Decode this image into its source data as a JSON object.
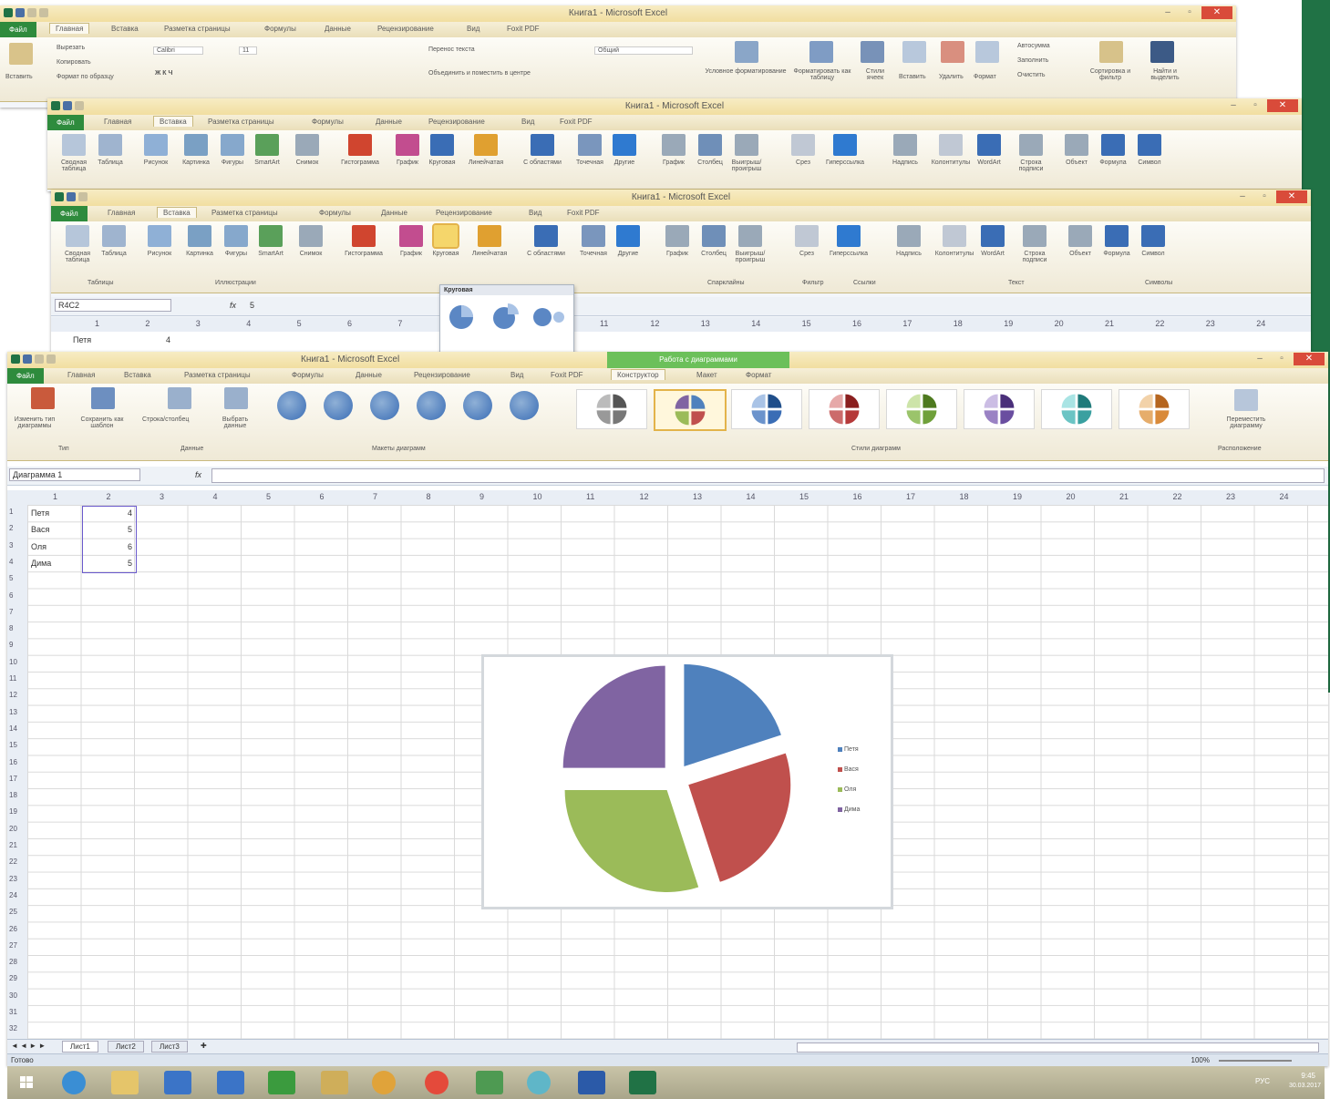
{
  "window": {
    "title": "Книга1 - Microsoft Excel"
  },
  "tabs": {
    "file": "Файл",
    "home": "Главная",
    "insert": "Вставка",
    "page_layout": "Разметка страницы",
    "formulas": "Формулы",
    "data": "Данные",
    "review": "Рецензирование",
    "view": "Вид",
    "foxit": "Foxit PDF",
    "design": "Конструктор",
    "layout": "Макет",
    "format": "Формат",
    "chart_tools": "Работа с диаграммами"
  },
  "home_ribbon": {
    "paste": "Вставить",
    "cut": "Вырезать",
    "copy": "Копировать",
    "format_painter": "Формат по образцу",
    "font": "Calibri",
    "font_size": "11",
    "wrap_text": "Перенос текста",
    "merge": "Объединить и поместить в центре",
    "number_format": "Общий",
    "conditional": "Условное форматирование",
    "format_table": "Форматировать как таблицу",
    "cell_styles": "Стили ячеек",
    "insert": "Вставить",
    "delete": "Удалить",
    "format": "Формат",
    "autosum": "Автосумма",
    "fill": "Заполнить",
    "clear": "Очистить",
    "sort": "Сортировка и фильтр",
    "find": "Найти и выделить"
  },
  "insert_ribbon": {
    "pivot": "Сводная таблица",
    "table": "Таблица",
    "picture": "Рисунок",
    "clipart": "Картинка",
    "shapes": "Фигуры",
    "smartart": "SmartArt",
    "screenshot": "Снимок",
    "histogram": "Гистограмма",
    "line": "График",
    "pie": "Круговая",
    "bar": "Линейчатая",
    "area": "С областями",
    "scatter": "Точечная",
    "other": "Другие",
    "spark_line": "График",
    "spark_column": "Столбец",
    "spark_winloss": "Выигрыш/проигрыш",
    "slicer": "Срез",
    "hyperlink": "Гиперссылка",
    "textbox": "Надпись",
    "header": "Колонтитулы",
    "wordart": "WordArt",
    "signature": "Строка подписи",
    "object": "Объект",
    "equation": "Формула",
    "symbol": "Символ",
    "group_tables": "Таблицы",
    "group_illustrations": "Иллюстрации",
    "group_sparklines": "Спарклайны",
    "group_filter": "Фильтр",
    "group_links": "Ссылки",
    "group_text": "Текст",
    "group_symbols": "Символы"
  },
  "pie_dropdown": {
    "header": "Круговая"
  },
  "window3_formula": {
    "name_box": "R4C2",
    "fx": "fx",
    "value": "5",
    "cell_a1": "Петя",
    "cell_b1": "4"
  },
  "design_ribbon": {
    "change_type": "Изменить тип диаграммы",
    "save_template": "Сохранить как шаблон",
    "switch_rowcol": "Строка/столбец",
    "select_data": "Выбрать данные",
    "move_chart": "Переместить диаграмму",
    "group_type": "Тип",
    "group_data": "Данные",
    "group_layouts": "Макеты диаграмм",
    "group_styles": "Стили диаграмм",
    "group_location": "Расположение"
  },
  "formula_bar": {
    "name_box": "Диаграмма 1",
    "fx": "fx",
    "value": ""
  },
  "columns": [
    "1",
    "2",
    "3",
    "4",
    "5",
    "6",
    "7",
    "8",
    "9",
    "10",
    "11",
    "12",
    "13",
    "14",
    "15",
    "16",
    "17",
    "18",
    "19",
    "20",
    "21",
    "22",
    "23",
    "24"
  ],
  "rows": [
    "1",
    "2",
    "3",
    "4",
    "5",
    "6",
    "7",
    "8",
    "9",
    "10",
    "11",
    "12",
    "13",
    "14",
    "15",
    "16",
    "17",
    "18",
    "19",
    "20",
    "21",
    "22",
    "23",
    "24",
    "25",
    "26",
    "27",
    "28",
    "29",
    "30",
    "31",
    "32"
  ],
  "table": [
    {
      "name": "Петя",
      "value": "4"
    },
    {
      "name": "Вася",
      "value": "5"
    },
    {
      "name": "Оля",
      "value": "6"
    },
    {
      "name": "Дима",
      "value": "5"
    }
  ],
  "chart_data": {
    "type": "pie",
    "exploded": true,
    "categories": [
      "Петя",
      "Вася",
      "Оля",
      "Дима"
    ],
    "values": [
      4,
      5,
      6,
      5
    ],
    "colors": [
      "#4f81bd",
      "#c0504d",
      "#9bbb59",
      "#8064a2"
    ],
    "legend": "right"
  },
  "sheets": {
    "active": "Лист1",
    "s2": "Лист2",
    "s3": "Лист3"
  },
  "status": {
    "ready": "Готово",
    "zoom": "100%"
  },
  "tray": {
    "lang": "РУС",
    "time": "9:45",
    "date": "30.03.2017"
  },
  "colors": {
    "excel_green": "#207245",
    "file_tab": "#2e8b3d",
    "close": "#d94b3a"
  }
}
